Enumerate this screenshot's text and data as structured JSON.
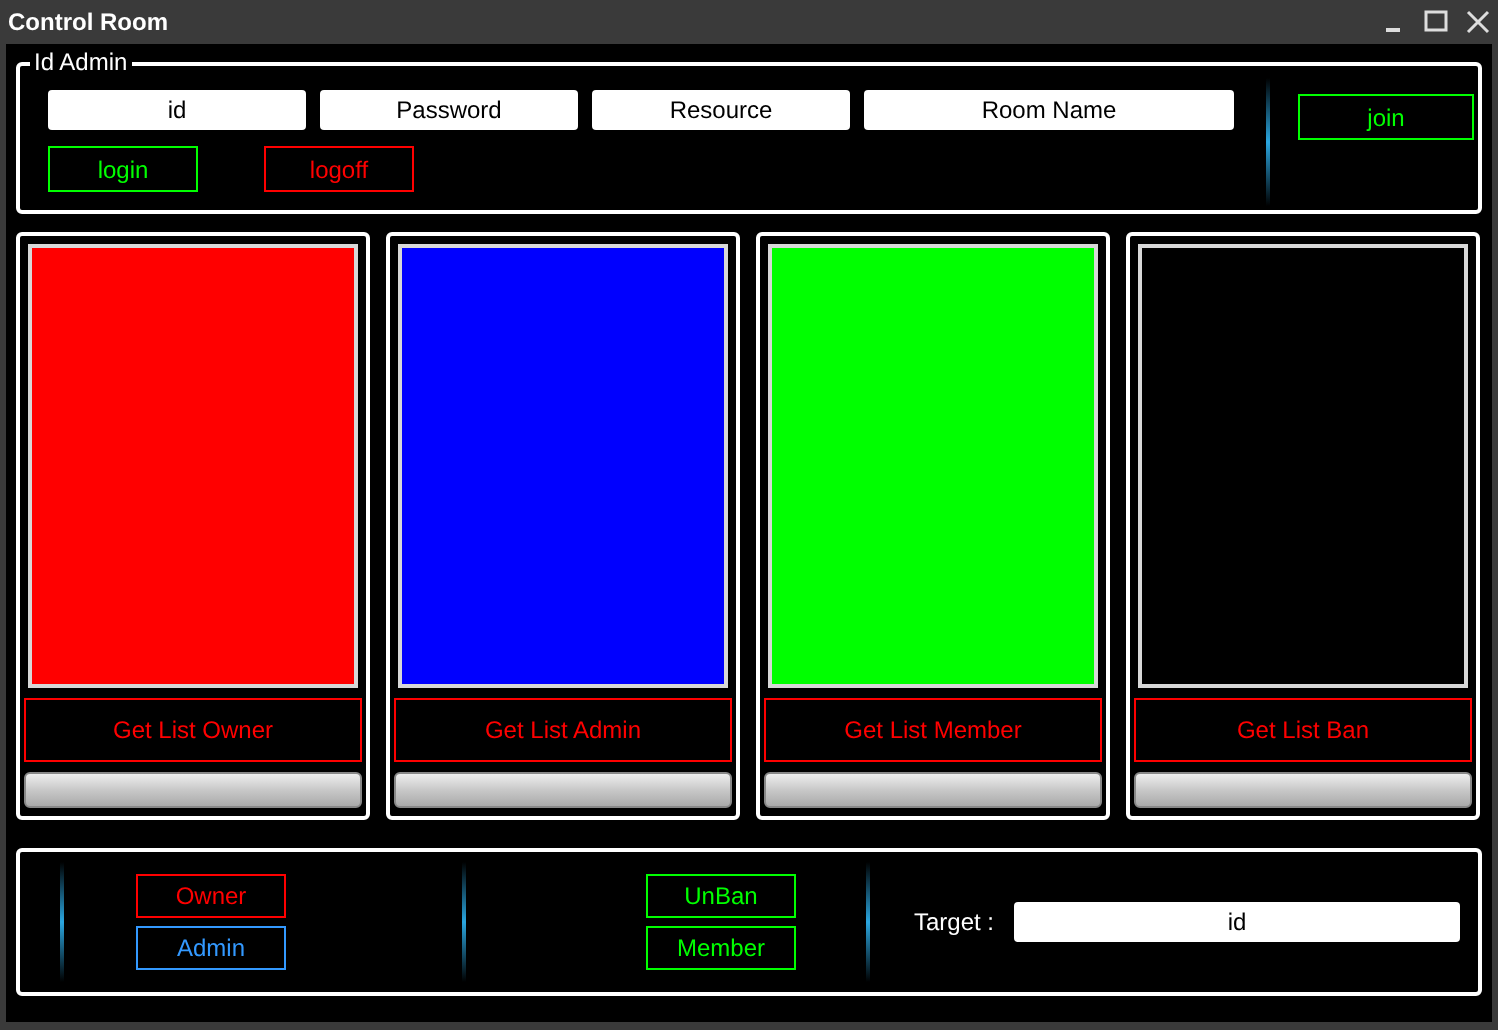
{
  "window": {
    "title": "Control Room"
  },
  "id_admin": {
    "title": "Id Admin",
    "fields": [
      {
        "value": "id"
      },
      {
        "value": "Password"
      },
      {
        "value": "Resource"
      },
      {
        "value": "Room Name"
      }
    ],
    "buttons": [
      {
        "label": "login",
        "color": "#00ff00"
      },
      {
        "label": "logoff",
        "color": "#ff0000"
      }
    ],
    "join": {
      "label": "join",
      "color": "#00ff00"
    }
  },
  "panels": [
    {
      "color": "#ff0000",
      "button": "Get List Owner",
      "level": 0
    },
    {
      "color": "#0000ff",
      "button": "Get List Admin",
      "level": 0
    },
    {
      "color": "#00ff00",
      "button": "Get List Member",
      "level": 0
    },
    {
      "color": "#000000",
      "button": "Get List Ban",
      "level": 0
    }
  ],
  "actions": {
    "left": [
      {
        "label": "Owner",
        "color": "#ff0000"
      },
      {
        "label": "Admin",
        "color": "#3399ff"
      }
    ],
    "middle": [
      {
        "label": "UnBan",
        "color": "#00ff00"
      },
      {
        "label": "Member",
        "color": "#00ff00"
      }
    ],
    "target_label": "Target :",
    "target": {
      "value": "id"
    }
  }
}
